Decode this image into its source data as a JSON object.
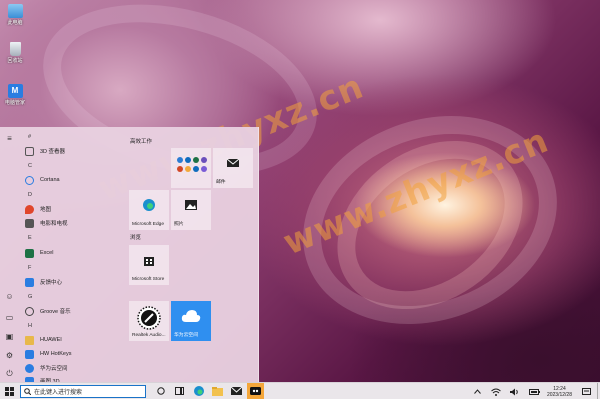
{
  "desktop_icons": [
    {
      "label": "此电脑",
      "icon": "computer-icon",
      "color": "#5aa6e6"
    },
    {
      "label": "回收站",
      "icon": "recycle-bin-icon",
      "color": "#c8d0d8"
    },
    {
      "label": "电脑管家",
      "icon": "pc-manager-icon",
      "color": "#2a7de1"
    }
  ],
  "watermarks": [
    "www.zhyxz.cn",
    "www.zhyxz.cn"
  ],
  "start_menu": {
    "rail_icons": [
      "hamburger-menu-icon",
      "user-icon",
      "document-icon",
      "pictures-icon",
      "settings-icon",
      "power-icon"
    ],
    "app_list": [
      {
        "type": "letter",
        "text": "#"
      },
      {
        "type": "app",
        "label": "3D 查看器",
        "icon": "3d-viewer-icon",
        "color": "#555"
      },
      {
        "type": "letter",
        "text": "C"
      },
      {
        "type": "app",
        "label": "Cortana",
        "icon": "cortana-icon",
        "color": "#2a7de1"
      },
      {
        "type": "letter",
        "text": "D"
      },
      {
        "type": "app",
        "label": "地图",
        "icon": "maps-icon",
        "color": "#e0462c"
      },
      {
        "type": "app",
        "label": "电影和电视",
        "icon": "movies-icon",
        "color": "#555"
      },
      {
        "type": "letter",
        "text": "E"
      },
      {
        "type": "app",
        "label": "Excel",
        "icon": "excel-icon",
        "color": "#1e7145"
      },
      {
        "type": "letter",
        "text": "F"
      },
      {
        "type": "app",
        "label": "反馈中心",
        "icon": "feedback-icon",
        "color": "#2a7de1"
      },
      {
        "type": "letter",
        "text": "G"
      },
      {
        "type": "app",
        "label": "Groove 音乐",
        "icon": "groove-music-icon",
        "color": "#444"
      },
      {
        "type": "letter",
        "text": "H"
      },
      {
        "type": "app",
        "label": "HUAWEI",
        "icon": "folder-icon",
        "color": "#e8b84a"
      },
      {
        "type": "app",
        "label": "HW HotKeys",
        "icon": "hotkeys-icon",
        "color": "#2a7de1"
      },
      {
        "type": "app",
        "label": "华为云空间",
        "icon": "huawei-cloud-icon",
        "color": "#2a7de1"
      },
      {
        "type": "app",
        "label": "画图 3D",
        "icon": "paint3d-icon",
        "color": "#2a7de1"
      }
    ],
    "groups": [
      {
        "title": "高效工作"
      },
      {
        "title": "浏览"
      }
    ],
    "tiles": [
      {
        "label": "",
        "icon": "office-apps-icon",
        "color": "#7a5bd6"
      },
      {
        "label": "邮件",
        "icon": "mail-icon",
        "color": "#222"
      },
      {
        "label": "Microsoft Edge",
        "icon": "edge-icon",
        "color": "#1a8fce"
      },
      {
        "label": "照片",
        "icon": "photos-icon",
        "color": "#222"
      },
      {
        "label": "Microsoft Store",
        "icon": "store-icon",
        "color": "#222"
      },
      {
        "label": "Realtek Audio...",
        "icon": "realtek-audio-icon",
        "color": "#111"
      },
      {
        "label": "华为云空间",
        "icon": "huawei-cloud-icon",
        "color": "#ffffff",
        "bg": "#2f8ff0"
      }
    ]
  },
  "taskbar": {
    "search_placeholder": "在此键入进行搜索",
    "pinned": [
      "task-view-icon",
      "multitask-icon",
      "edge-icon",
      "file-explorer-icon",
      "mail-icon",
      "huawei-app-icon"
    ],
    "tray_icons": [
      "chevron-up-icon",
      "network-icon",
      "volume-icon",
      "battery-icon"
    ],
    "time": "12:24",
    "date": "2023/12/28"
  }
}
